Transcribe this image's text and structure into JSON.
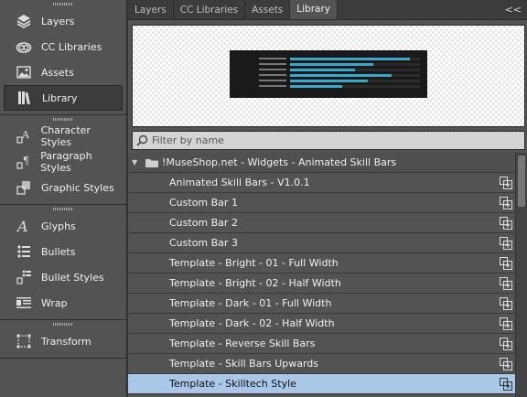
{
  "dock": {
    "group1": [
      {
        "label": "Layers",
        "icon": "layers-icon"
      },
      {
        "label": "CC Libraries",
        "icon": "cc-libraries-icon"
      },
      {
        "label": "Assets",
        "icon": "assets-icon"
      },
      {
        "label": "Library",
        "icon": "library-icon",
        "active": true
      }
    ],
    "group2": [
      {
        "label": "Character Styles",
        "icon": "character-styles-icon"
      },
      {
        "label": "Paragraph Styles",
        "icon": "paragraph-styles-icon"
      },
      {
        "label": "Graphic Styles",
        "icon": "graphic-styles-icon"
      }
    ],
    "group3": [
      {
        "label": "Glyphs",
        "icon": "glyphs-icon"
      },
      {
        "label": "Bullets",
        "icon": "bullets-icon"
      },
      {
        "label": "Bullet Styles",
        "icon": "bullet-styles-icon"
      },
      {
        "label": "Wrap",
        "icon": "wrap-icon"
      }
    ],
    "group4": [
      {
        "label": "Transform",
        "icon": "transform-icon"
      }
    ]
  },
  "panel": {
    "tabs": [
      "Layers",
      "CC Libraries",
      "Assets",
      "Library"
    ],
    "active_tab": "Library",
    "collapse_label": "<<",
    "filter_placeholder": "Filter by name",
    "preview_bars": [
      0.92,
      0.64,
      0.5,
      0.78,
      0.6,
      0.4
    ],
    "folder_name": "!MuseShop.net - Widgets - Animated Skill Bars",
    "items": [
      "Animated Skill Bars - V1.0.1",
      "Custom Bar 1",
      "Custom Bar 2",
      "Custom Bar 3",
      "Template - Bright - 01 - Full Width",
      "Template - Bright - 02 - Half Width",
      "Template - Dark - 01 - Full Width",
      "Template - Dark - 02 - Half Width",
      "Template - Reverse Skill Bars",
      "Template - Skill Bars Upwards",
      "Template - Skilltech Style"
    ],
    "selected_item": "Template - Skilltech Style"
  },
  "colors": {
    "accent_bar": "#3ea6c8",
    "selected_row": "#a9c8e8"
  }
}
